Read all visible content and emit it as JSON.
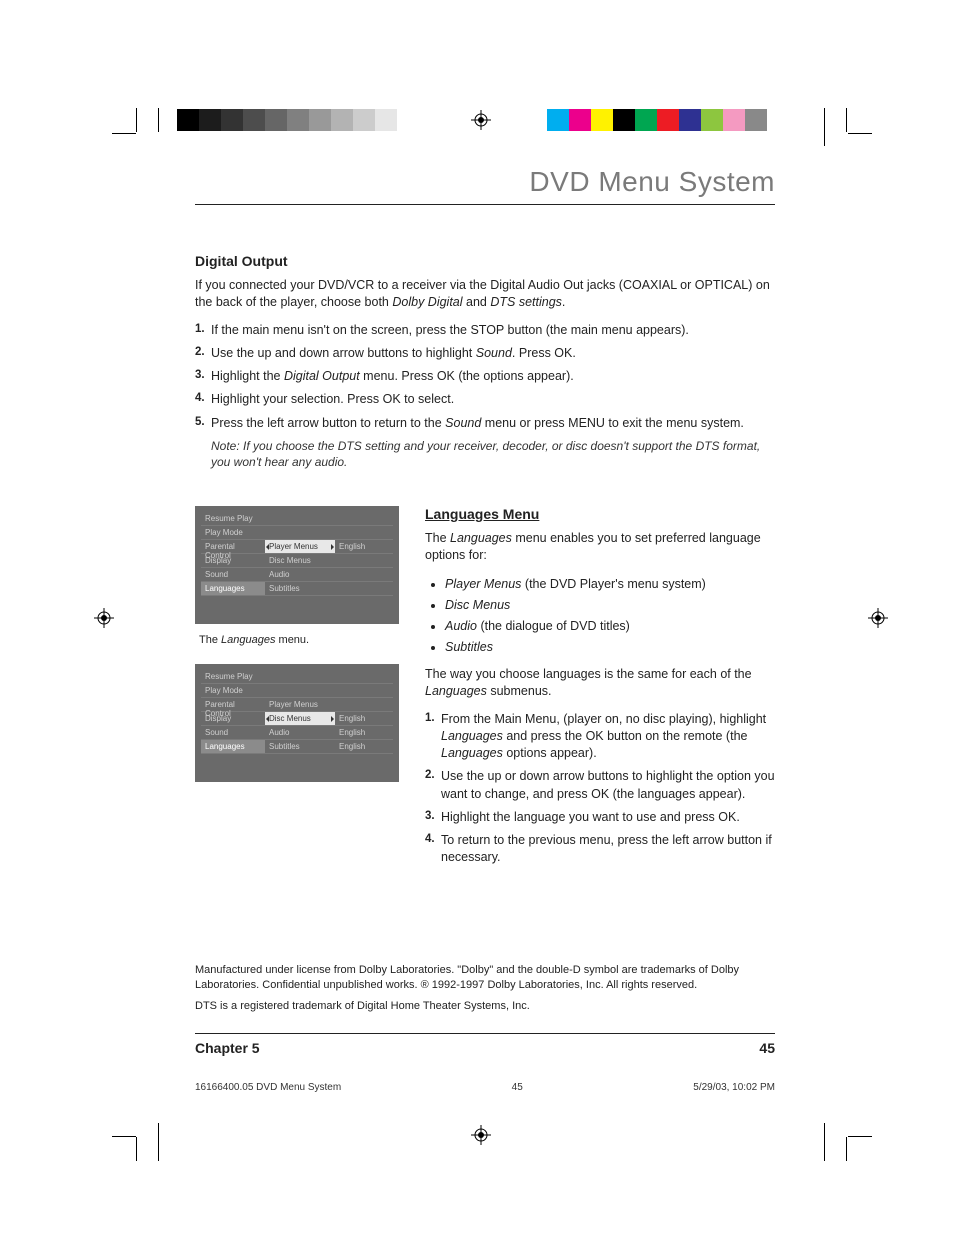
{
  "header": {
    "title": "DVD Menu System"
  },
  "digital_output": {
    "heading": "Digital Output",
    "intro_a": "If you connected your DVD/VCR to a receiver via the Digital Audio Out jacks (COAXIAL or OPTICAL) on the back of the player, choose both ",
    "intro_i1": "Dolby Digital",
    "intro_b": " and ",
    "intro_i2": "DTS settings",
    "intro_c": ".",
    "steps": [
      "If the main menu isn't on the screen, press the STOP button (the main menu appears).",
      "Highlight your selection. Press OK to select."
    ],
    "step2_a": "Use the up and down arrow buttons to highlight ",
    "step2_i": "Sound",
    "step2_b": ". Press OK.",
    "step3_a": "Highlight the ",
    "step3_i": "Digital Output",
    "step3_b": " menu. Press OK (the options appear).",
    "step5_a": "Press the left arrow button to return to the ",
    "step5_i": "Sound",
    "step5_b": " menu or press MENU to exit the menu system.",
    "note": "Note: If you choose the DTS setting and your receiver, decoder, or disc doesn't support the DTS format, you won't hear any audio."
  },
  "menus": {
    "left_items": [
      "Resume Play",
      "Play Mode",
      "Parental Control",
      "Display",
      "Sound",
      "Languages"
    ],
    "mid1": [
      "Player Menus",
      "Disc Menus",
      "Audio",
      "Subtitles"
    ],
    "r1": "English",
    "mid2": [
      "Player Menus",
      "Disc Menus",
      "Audio",
      "Subtitles"
    ],
    "r2": [
      "",
      "English",
      "English",
      "English"
    ]
  },
  "caption1_a": "The ",
  "caption1_i": "Languages",
  "caption1_b": " menu.",
  "languages": {
    "heading": "Languages Menu",
    "intro_a": "The ",
    "intro_i": "Languages",
    "intro_b": " menu enables you to set preferred language options for:",
    "b1_i": "Player Menus",
    "b1_b": " (the DVD Player's menu system)",
    "b2": "Disc Menus",
    "b3_i": "Audio",
    "b3_b": " (the dialogue of DVD titles)",
    "b4": "Subtitles",
    "way_a": "The way you choose languages is the same for each of the ",
    "way_i": "Languages",
    "way_b": " submenus.",
    "s1_a": "From the Main Menu, (player on, no disc playing), highlight ",
    "s1_i1": "Languages",
    "s1_b": " and press the OK button on the remote (the ",
    "s1_i2": "Languages",
    "s1_c": " options appear).",
    "s2": "Use the up or down arrow buttons to highlight the option you want to change, and press OK (the languages appear).",
    "s3": "Highlight the language you want to use and press OK.",
    "s4": "To return to the previous menu, press the left arrow button if necessary."
  },
  "legal": {
    "p1": "Manufactured under license from Dolby Laboratories. \"Dolby\" and the double-D symbol are trademarks of Dolby Laboratories. Confidential unpublished works. ® 1992-1997 Dolby Laboratories, Inc. All rights reserved.",
    "p2": "DTS is a registered trademark of Digital Home Theater Systems, Inc."
  },
  "footer": {
    "chapter": "Chapter 5",
    "page": "45"
  },
  "print": {
    "doc": "16166400.05 DVD Menu System",
    "pg": "45",
    "ts": "5/29/03, 10:02 PM"
  },
  "swatches": {
    "gray": [
      "#000000",
      "#1c1c1c",
      "#333333",
      "#4d4d4d",
      "#666666",
      "#808080",
      "#999999",
      "#b3b3b3",
      "#cccccc",
      "#e6e6e6"
    ],
    "color": [
      "#00aeef",
      "#ec008c",
      "#fff200",
      "#000000",
      "#00a651",
      "#ed1c24",
      "#2e3192",
      "#8dc63f",
      "#f49ac1",
      "#898989"
    ]
  }
}
